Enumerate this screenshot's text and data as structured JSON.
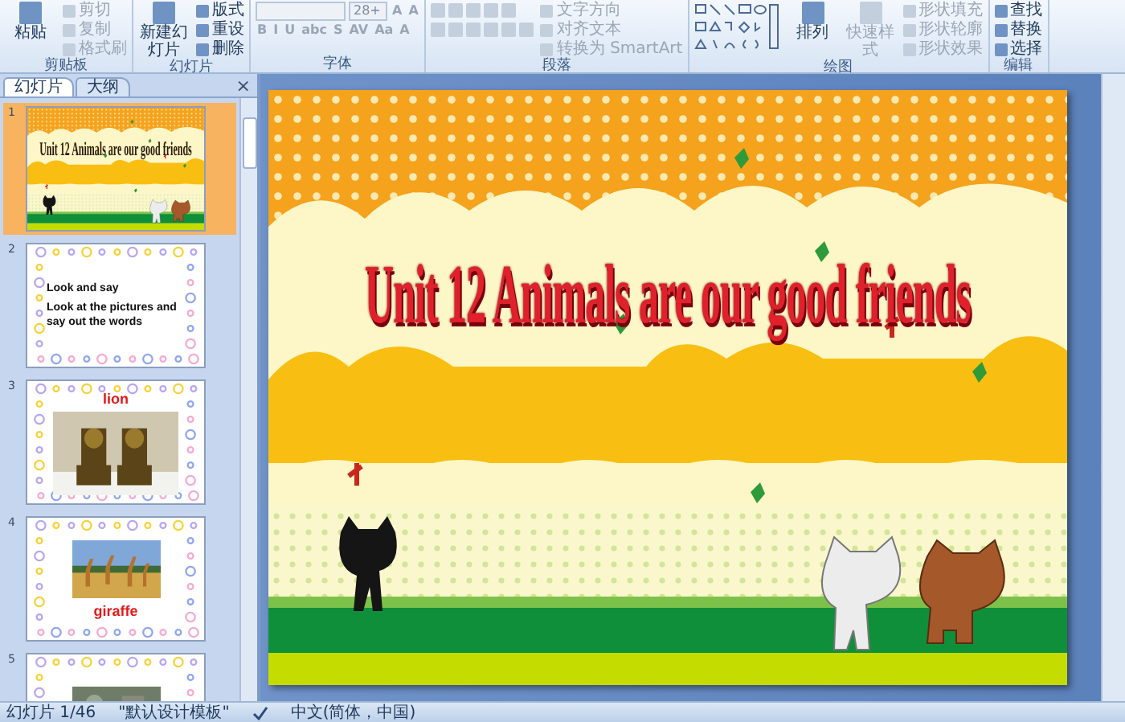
{
  "ribbon": {
    "groups": [
      {
        "label": "剪贴板",
        "columns": [
          [
            [
              {
                "kind": "large",
                "label": "粘贴",
                "disabled": false
              }
            ]
          ],
          [
            [
              {
                "kind": "small",
                "label": "剪切",
                "disabled": true
              }
            ],
            [
              {
                "kind": "small",
                "label": "复制",
                "disabled": true
              }
            ],
            [
              {
                "kind": "small",
                "label": "格式刷",
                "disabled": true
              }
            ]
          ]
        ]
      },
      {
        "label": "幻灯片",
        "columns": [
          [
            [
              {
                "kind": "large",
                "label": "新建幻灯片",
                "disabled": false
              }
            ]
          ],
          [
            [
              {
                "kind": "small",
                "label": "版式",
                "disabled": false
              }
            ],
            [
              {
                "kind": "small",
                "label": "重设",
                "disabled": false
              }
            ],
            [
              {
                "kind": "small",
                "label": "删除",
                "disabled": false
              }
            ]
          ]
        ]
      },
      {
        "label": "字体",
        "columns": [
          [
            [
              {
                "kind": "field",
                "disabled": true
              },
              {
                "kind": "field",
                "value": "28+",
                "disabled": true
              },
              {
                "kind": "glyph",
                "label": "A",
                "disabled": true
              },
              {
                "kind": "glyph",
                "label": "A",
                "disabled": true
              }
            ],
            [
              {
                "kind": "glyph",
                "label": "B",
                "disabled": true
              },
              {
                "kind": "glyph",
                "label": "I",
                "disabled": true
              },
              {
                "kind": "glyph",
                "label": "U",
                "disabled": true
              },
              {
                "kind": "glyph",
                "label": "abc",
                "disabled": true
              },
              {
                "kind": "glyph",
                "label": "S",
                "disabled": true
              },
              {
                "kind": "glyph",
                "label": "AV",
                "disabled": true
              },
              {
                "kind": "glyph",
                "label": "Aa",
                "disabled": true
              },
              {
                "kind": "glyph",
                "label": "A",
                "disabled": true
              }
            ]
          ]
        ]
      },
      {
        "label": "段落",
        "columns": [
          [
            [
              {
                "kind": "icon",
                "disabled": true
              },
              {
                "kind": "icon",
                "disabled": true
              },
              {
                "kind": "icon",
                "disabled": true
              },
              {
                "kind": "icon",
                "disabled": true
              },
              {
                "kind": "icon",
                "disabled": true
              }
            ],
            [
              {
                "kind": "icon",
                "disabled": true
              },
              {
                "kind": "icon",
                "disabled": true
              },
              {
                "kind": "icon",
                "disabled": true
              },
              {
                "kind": "icon",
                "disabled": true
              },
              {
                "kind": "icon",
                "disabled": true
              },
              {
                "kind": "icon",
                "disabled": true
              }
            ]
          ],
          [
            [
              {
                "kind": "small",
                "label": "文字方向",
                "disabled": true
              }
            ],
            [
              {
                "kind": "small",
                "label": "对齐文本",
                "disabled": true
              }
            ],
            [
              {
                "kind": "small",
                "label": "转换为 SmartArt",
                "disabled": true
              }
            ]
          ]
        ]
      },
      {
        "label": "绘图",
        "columns": [
          [
            [
              {
                "kind": "shapes",
                "disabled": false
              }
            ]
          ],
          [
            [
              {
                "kind": "large",
                "label": "排列",
                "disabled": false
              }
            ]
          ],
          [
            [
              {
                "kind": "large",
                "label": "快速样式",
                "disabled": true
              }
            ]
          ],
          [
            [
              {
                "kind": "small",
                "label": "形状填充",
                "disabled": true
              }
            ],
            [
              {
                "kind": "small",
                "label": "形状轮廓",
                "disabled": true
              }
            ],
            [
              {
                "kind": "small",
                "label": "形状效果",
                "disabled": true
              }
            ]
          ]
        ]
      },
      {
        "label": "编辑",
        "columns": [
          [
            [
              {
                "kind": "small",
                "label": "查找",
                "disabled": false
              }
            ],
            [
              {
                "kind": "small",
                "label": "替换",
                "disabled": false
              }
            ],
            [
              {
                "kind": "small",
                "label": "选择",
                "disabled": false
              }
            ]
          ]
        ]
      }
    ]
  },
  "sidebar": {
    "tabs": [
      {
        "label": "幻灯片",
        "selected": true
      },
      {
        "label": "大纲",
        "selected": false
      }
    ],
    "close": "×",
    "slides": [
      {
        "number": "1",
        "kind": "title",
        "selected": true,
        "title": "Unit 12 Animals are our good friends"
      },
      {
        "number": "2",
        "kind": "text",
        "selected": false,
        "lines": [
          "Look and say",
          "Look at the pictures and say out the words"
        ]
      },
      {
        "number": "3",
        "kind": "caption_above",
        "selected": false,
        "caption": "lion"
      },
      {
        "number": "4",
        "kind": "caption_below",
        "selected": false,
        "caption": "giraffe"
      },
      {
        "number": "5",
        "selected": false
      }
    ]
  },
  "slide": {
    "title": "Unit 12 Animals are our good friends"
  },
  "status_bar": {
    "slide_count": "幻灯片 1/46",
    "theme": "\"默认设计模板\"",
    "language": "中文(简体，中国)"
  }
}
